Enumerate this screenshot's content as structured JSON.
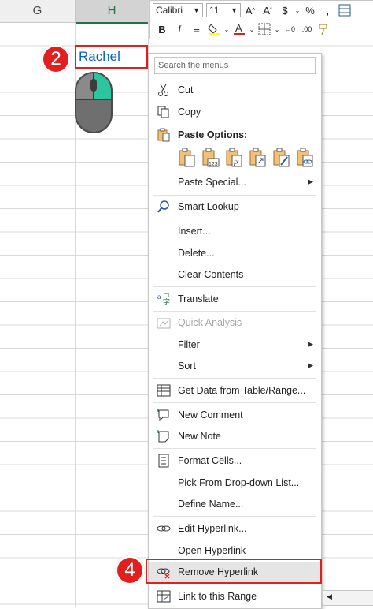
{
  "sheet": {
    "columns": [
      "G",
      "H"
    ],
    "cell_h2": {
      "value": "Rachel"
    }
  },
  "badges": {
    "step2": "2",
    "step4": "4"
  },
  "mini_toolbar": {
    "font_name": "Calibri",
    "font_size": "11",
    "currency": "$",
    "percent": "%",
    "bold": "B",
    "italic": "I"
  },
  "context_menu": {
    "search_placeholder": "Search the menus",
    "items": [
      {
        "label": "Cut"
      },
      {
        "label": "Copy"
      },
      {
        "label": "Paste Options:"
      },
      {
        "label": "Paste Special..."
      },
      {
        "label": "Smart Lookup"
      },
      {
        "label": "Insert..."
      },
      {
        "label": "Delete..."
      },
      {
        "label": "Clear Contents"
      },
      {
        "label": "Translate"
      },
      {
        "label": "Quick Analysis"
      },
      {
        "label": "Filter"
      },
      {
        "label": "Sort"
      },
      {
        "label": "Get Data from Table/Range..."
      },
      {
        "label": "New Comment"
      },
      {
        "label": "New Note"
      },
      {
        "label": "Format Cells..."
      },
      {
        "label": "Pick From Drop-down List..."
      },
      {
        "label": "Define Name..."
      },
      {
        "label": "Edit Hyperlink..."
      },
      {
        "label": "Open Hyperlink"
      },
      {
        "label": "Remove Hyperlink"
      },
      {
        "label": "Link to this Range"
      }
    ]
  },
  "colors": {
    "accent_red": "#e0201e",
    "hyperlink": "#0563c1",
    "excel_green": "#217346",
    "mouse_button": "#2ec4a0"
  }
}
